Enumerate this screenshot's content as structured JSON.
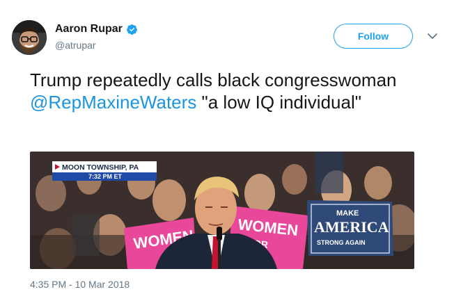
{
  "author": {
    "display_name": "Aaron Rupar",
    "handle": "@atrupar",
    "verified": true
  },
  "follow_label": "Follow",
  "tweet": {
    "text_before": "Trump repeatedly calls black congresswoman ",
    "mention": "@RepMaxineWaters",
    "text_after": " \"a low IQ individual\""
  },
  "media": {
    "location_banner": "MOON TOWNSHIP, PA",
    "time_banner": "7:32 PM ET",
    "sign_women_1": "WOMEN",
    "sign_women_2": "WOMEN",
    "sign_for": "FOR",
    "sign_make": "MAKE",
    "sign_america": "AMERICA",
    "sign_strong": "STRONG AGAIN"
  },
  "timestamp": "4:35 PM - 10 Mar 2018",
  "colors": {
    "link": "#1b95e0",
    "follow": "#1da1f2",
    "secondary_text": "#657786",
    "verified": "#1da1f2"
  }
}
